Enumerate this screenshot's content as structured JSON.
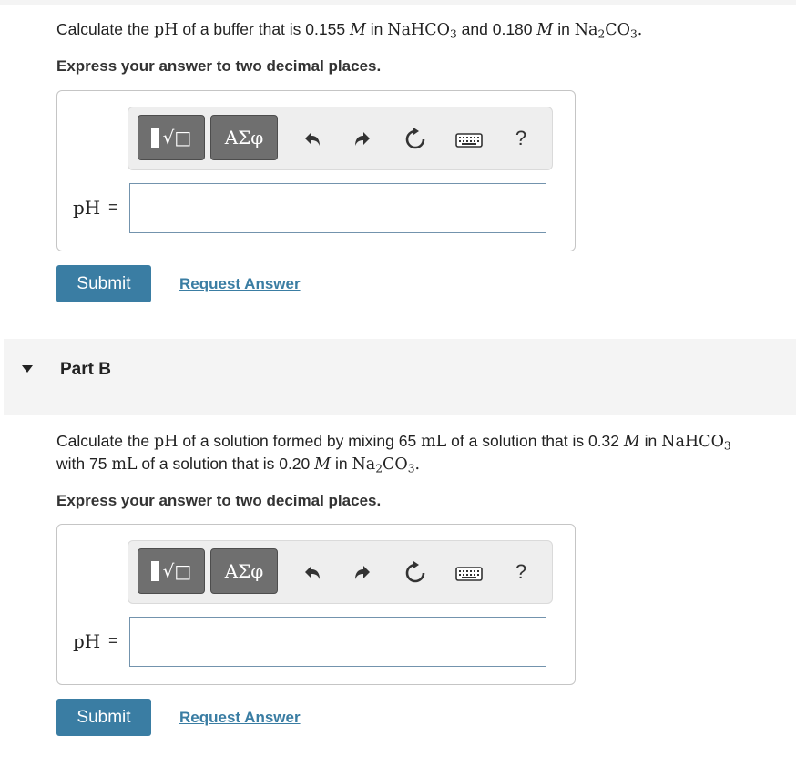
{
  "part_a": {
    "question": {
      "pre": "Calculate the",
      "ph": "pH",
      "mid1": "of a buffer that is 0.155",
      "m1": "M",
      "mid2": "in",
      "c1_a": "NaHCO",
      "c1_sub": "3",
      "mid3": "and 0.180",
      "m2": "M",
      "mid4": "in",
      "c2_a": "Na",
      "c2_sub1": "2",
      "c2_b": "CO",
      "c2_sub2": "3",
      "end": "."
    },
    "instruction": "Express your answer to two decimal places.",
    "toolbar": {
      "template_label": "√□",
      "symbols_label": "ΑΣφ",
      "help_label": "?"
    },
    "answer_label": "pH",
    "equals": "=",
    "input_value": "",
    "submit_label": "Submit",
    "request_label": "Request Answer"
  },
  "part_b": {
    "title": "Part B",
    "question": {
      "pre": "Calculate the",
      "ph": "pH",
      "mid1": "of a solution formed by mixing 65",
      "u1": "mL",
      "mid2": "of a solution that is 0.32",
      "m1": "M",
      "mid3": "in",
      "c1_a": "NaHCO",
      "c1_sub": "3",
      "mid4": "with 75",
      "u2": "mL",
      "mid5": "of a solution that is 0.20",
      "m2": "M",
      "mid6": "in",
      "c2_a": "Na",
      "c2_sub1": "2",
      "c2_b": "CO",
      "c2_sub2": "3",
      "end": "."
    },
    "instruction": "Express your answer to two decimal places.",
    "toolbar": {
      "template_label": "√□",
      "symbols_label": "ΑΣφ",
      "help_label": "?"
    },
    "answer_label": "pH",
    "equals": "=",
    "input_value": "",
    "submit_label": "Submit",
    "request_label": "Request Answer"
  },
  "colors": {
    "accent": "#3a7da3",
    "toolbar_button": "#6f6f6f",
    "band": "#f4f4f4"
  },
  "icons": [
    "undo-icon",
    "redo-icon",
    "reset-icon",
    "keyboard-icon",
    "help-icon",
    "template-icon",
    "caret-down-icon"
  ]
}
